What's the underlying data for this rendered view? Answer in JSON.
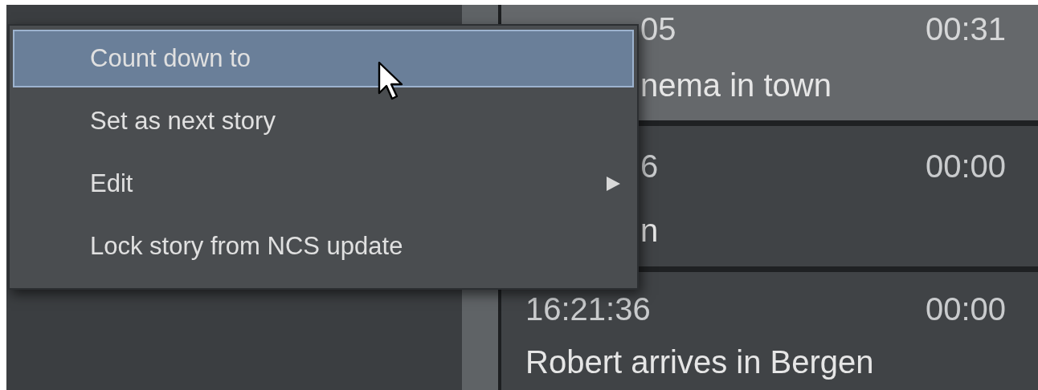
{
  "story_list": {
    "rows": [
      {
        "time": "05",
        "duration": "00:31",
        "title": "nema in town",
        "selected": true
      },
      {
        "time": "6",
        "duration": "00:00",
        "title": "n",
        "selected": false
      },
      {
        "time": "16:21:36",
        "duration": "00:00",
        "title": "Robert arrives in Bergen",
        "selected": false
      }
    ]
  },
  "context_menu": {
    "items": [
      {
        "label": "Count down to",
        "selected": true,
        "submenu": false
      },
      {
        "label": "Set as next story",
        "selected": false,
        "submenu": false
      },
      {
        "label": "Edit",
        "selected": false,
        "submenu": true
      },
      {
        "label": "Lock story from NCS update",
        "selected": false,
        "submenu": false
      }
    ]
  }
}
